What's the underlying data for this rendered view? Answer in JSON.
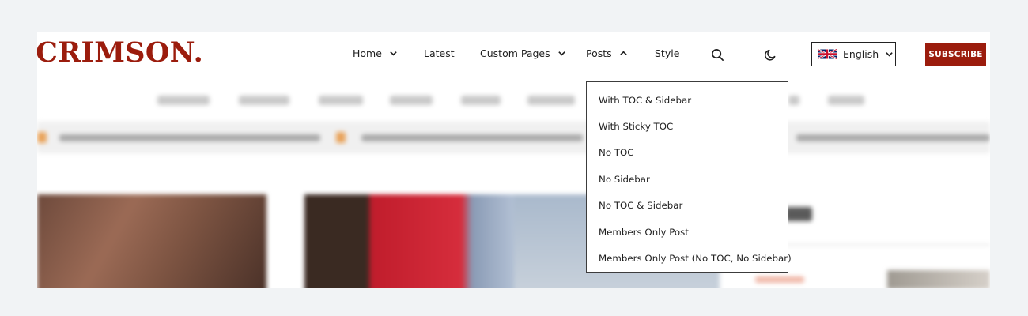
{
  "brand": {
    "logo_text": "CRIMSON.",
    "color": "#9b1c0d"
  },
  "nav": {
    "home": "Home",
    "latest": "Latest",
    "custom_pages": "Custom Pages",
    "posts": "Posts",
    "style": "Style"
  },
  "icons": {
    "search": "search-icon",
    "theme": "moon-icon",
    "flag": "uk-flag-icon"
  },
  "language": {
    "selected": "English"
  },
  "subscribe_label": "SUBSCRIBE",
  "posts_menu": {
    "items": [
      "With TOC & Sidebar",
      "With Sticky TOC",
      "No TOC",
      "No Sidebar",
      "No TOC & Sidebar",
      "Members Only Post",
      "Members Only Post (No TOC, No Sidebar)"
    ]
  }
}
